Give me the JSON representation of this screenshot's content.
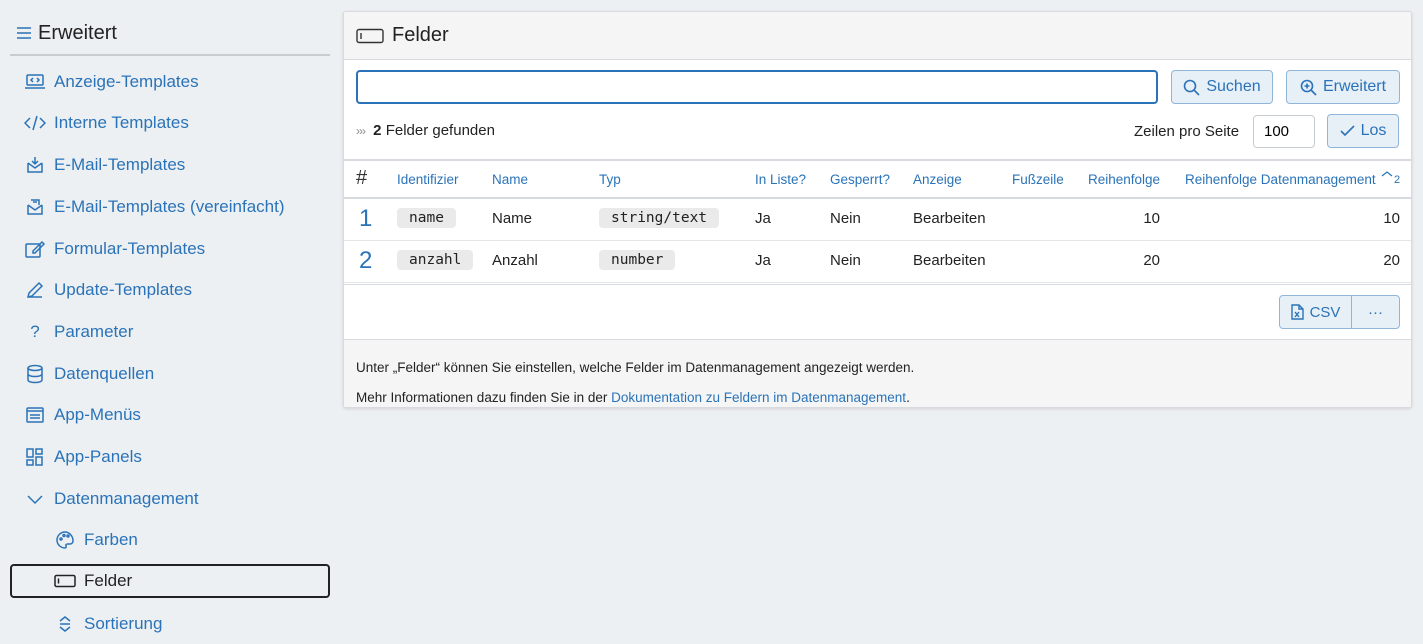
{
  "sidebar": {
    "title": "Erweitert",
    "items": [
      {
        "label": "Anzeige-Templates",
        "icon": "laptop-code-icon"
      },
      {
        "label": "Interne Templates",
        "icon": "code-icon"
      },
      {
        "label": "E-Mail-Templates",
        "icon": "mail-download-icon"
      },
      {
        "label": "E-Mail-Templates (vereinfacht)",
        "icon": "mail-list-icon"
      },
      {
        "label": "Formular-Templates",
        "icon": "form-edit-icon"
      },
      {
        "label": "Update-Templates",
        "icon": "pencil-icon"
      },
      {
        "label": "Parameter",
        "icon": "question-icon"
      },
      {
        "label": "Datenquellen",
        "icon": "database-icon"
      },
      {
        "label": "App-Menüs",
        "icon": "menu-window-icon"
      },
      {
        "label": "App-Panels",
        "icon": "panels-grid-icon"
      },
      {
        "label": "Datenmanagement",
        "icon": "chevron-down-icon"
      },
      {
        "label": "Farben",
        "icon": "palette-icon"
      },
      {
        "label": "Felder",
        "icon": "input-field-icon"
      },
      {
        "label": "Sortierung",
        "icon": "sort-icon"
      }
    ]
  },
  "card": {
    "title": "Felder",
    "search": {
      "value": "",
      "placeholder": ""
    },
    "search_button": "Suchen",
    "advanced_button": "Erweitert",
    "found_count": "2",
    "found_label": "Felder gefunden",
    "rows_label": "Zeilen pro Seite",
    "rows_value": "100",
    "go_button": "Los",
    "table": {
      "headers": {
        "hash": "#",
        "identifier": "Identifizier",
        "name": "Name",
        "type": "Typ",
        "in_list": "In Liste?",
        "locked": "Gesperrt?",
        "display": "Anzeige",
        "footer": "Fußzeile",
        "order": "Reihenfolge",
        "order_dm": "Reihenfolge Datenmanagement",
        "sort_index": "2"
      },
      "rows": [
        {
          "num": "1",
          "identifier": "name",
          "name": "Name",
          "type": "string/text",
          "in_list": "Ja",
          "locked": "Nein",
          "display": "Bearbeiten",
          "footer": "",
          "order": "10",
          "order_dm": "10"
        },
        {
          "num": "2",
          "identifier": "anzahl",
          "name": "Anzahl",
          "type": "number",
          "in_list": "Ja",
          "locked": "Nein",
          "display": "Bearbeiten",
          "footer": "",
          "order": "20",
          "order_dm": "20"
        }
      ]
    },
    "csv_button": "CSV",
    "more_button": "···",
    "info_line1": "Unter „Felder“ können Sie einstellen, welche Felder im Datenmanagement angezeigt werden.",
    "info_line2_prefix": "Mehr Informationen dazu finden Sie in der ",
    "info_link": "Dokumentation zu Feldern im Datenmanagement",
    "info_line2_suffix": "."
  },
  "colors": {
    "accent": "#2a73b8",
    "background": "#edf0f3",
    "button_bg": "#e7eff7"
  }
}
